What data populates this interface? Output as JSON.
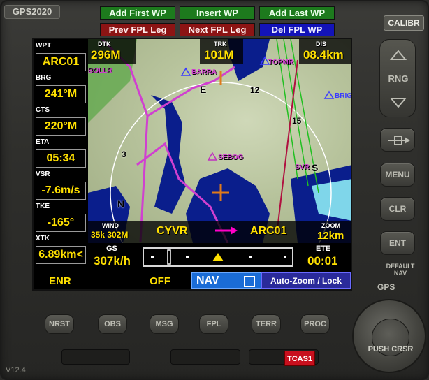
{
  "device": {
    "model": "GPS2020",
    "version": "V12.4",
    "calibrate_label": "CALIBR"
  },
  "top_buttons": {
    "add_first_wp": "Add First WP",
    "insert_wp": "Insert WP",
    "add_last_wp": "Add Last WP",
    "prev_fpl_leg": "Prev FPL Leg",
    "next_fpl_leg": "Next FPL Leg",
    "del_fpl_wp": "Del FPL WP"
  },
  "data_fields": [
    {
      "label": "WPT",
      "value": "ARC01"
    },
    {
      "label": "BRG",
      "value": "241°M"
    },
    {
      "label": "CTS",
      "value": "220°M"
    },
    {
      "label": "ETA",
      "value": "05:34"
    },
    {
      "label": "VSR",
      "value": "-7.6m/s"
    },
    {
      "label": "TKE",
      "value": "-165°"
    },
    {
      "label": "XTK",
      "value": "6.89km<"
    }
  ],
  "map_header": {
    "dtk_label": "DTK",
    "dtk_value": "296M",
    "trk_label": "TRK",
    "trk_value": "101M",
    "dis_label": "DIS",
    "dis_value": "08.4km"
  },
  "map_labels": {
    "waypoints": [
      "BOLLR",
      "BARRA",
      "TOPMR",
      "BRIG",
      "SEBOG",
      "SVR"
    ],
    "compass": [
      "E",
      "12",
      "15",
      "S",
      "3",
      "N"
    ]
  },
  "map_footer": {
    "wind_label": "WIND",
    "wind_value": "35k 302M",
    "from": "CYVR",
    "to": "ARC01",
    "zoom_label": "ZOOM",
    "zoom_value": "12km"
  },
  "bottom_bar": {
    "gs_label": "GS",
    "gs_value": "307k/h",
    "ete_label": "ETE",
    "ete_value": "00:01"
  },
  "status_bar": {
    "mode": "ENR",
    "flag": "OFF",
    "nav": "NAV",
    "autozoom": "Auto-Zoom / Lock"
  },
  "side_buttons": {
    "rng": "RNG",
    "direct_to": "-D->",
    "menu": "MENU",
    "clr": "CLR",
    "ent": "ENT",
    "default_nav": "DEFAULT NAV",
    "gps": "GPS"
  },
  "bottom_buttons": [
    "NRST",
    "OBS",
    "MSG",
    "FPL",
    "TERR",
    "PROC"
  ],
  "tcas_label": "TCAS1",
  "knob_label": "PUSH CRSR",
  "colors": {
    "accent_yellow": "#ffe000",
    "route_magenta": "#d040d0",
    "water": "#0a1e8c",
    "add_green": "#1d7a1d",
    "leg_red": "#8c1414",
    "del_blue": "#1313b8"
  },
  "icons": [
    "aircraft-icon",
    "route-arrow-icon",
    "direct-to-icon",
    "range-up-icon",
    "range-down-icon"
  ]
}
